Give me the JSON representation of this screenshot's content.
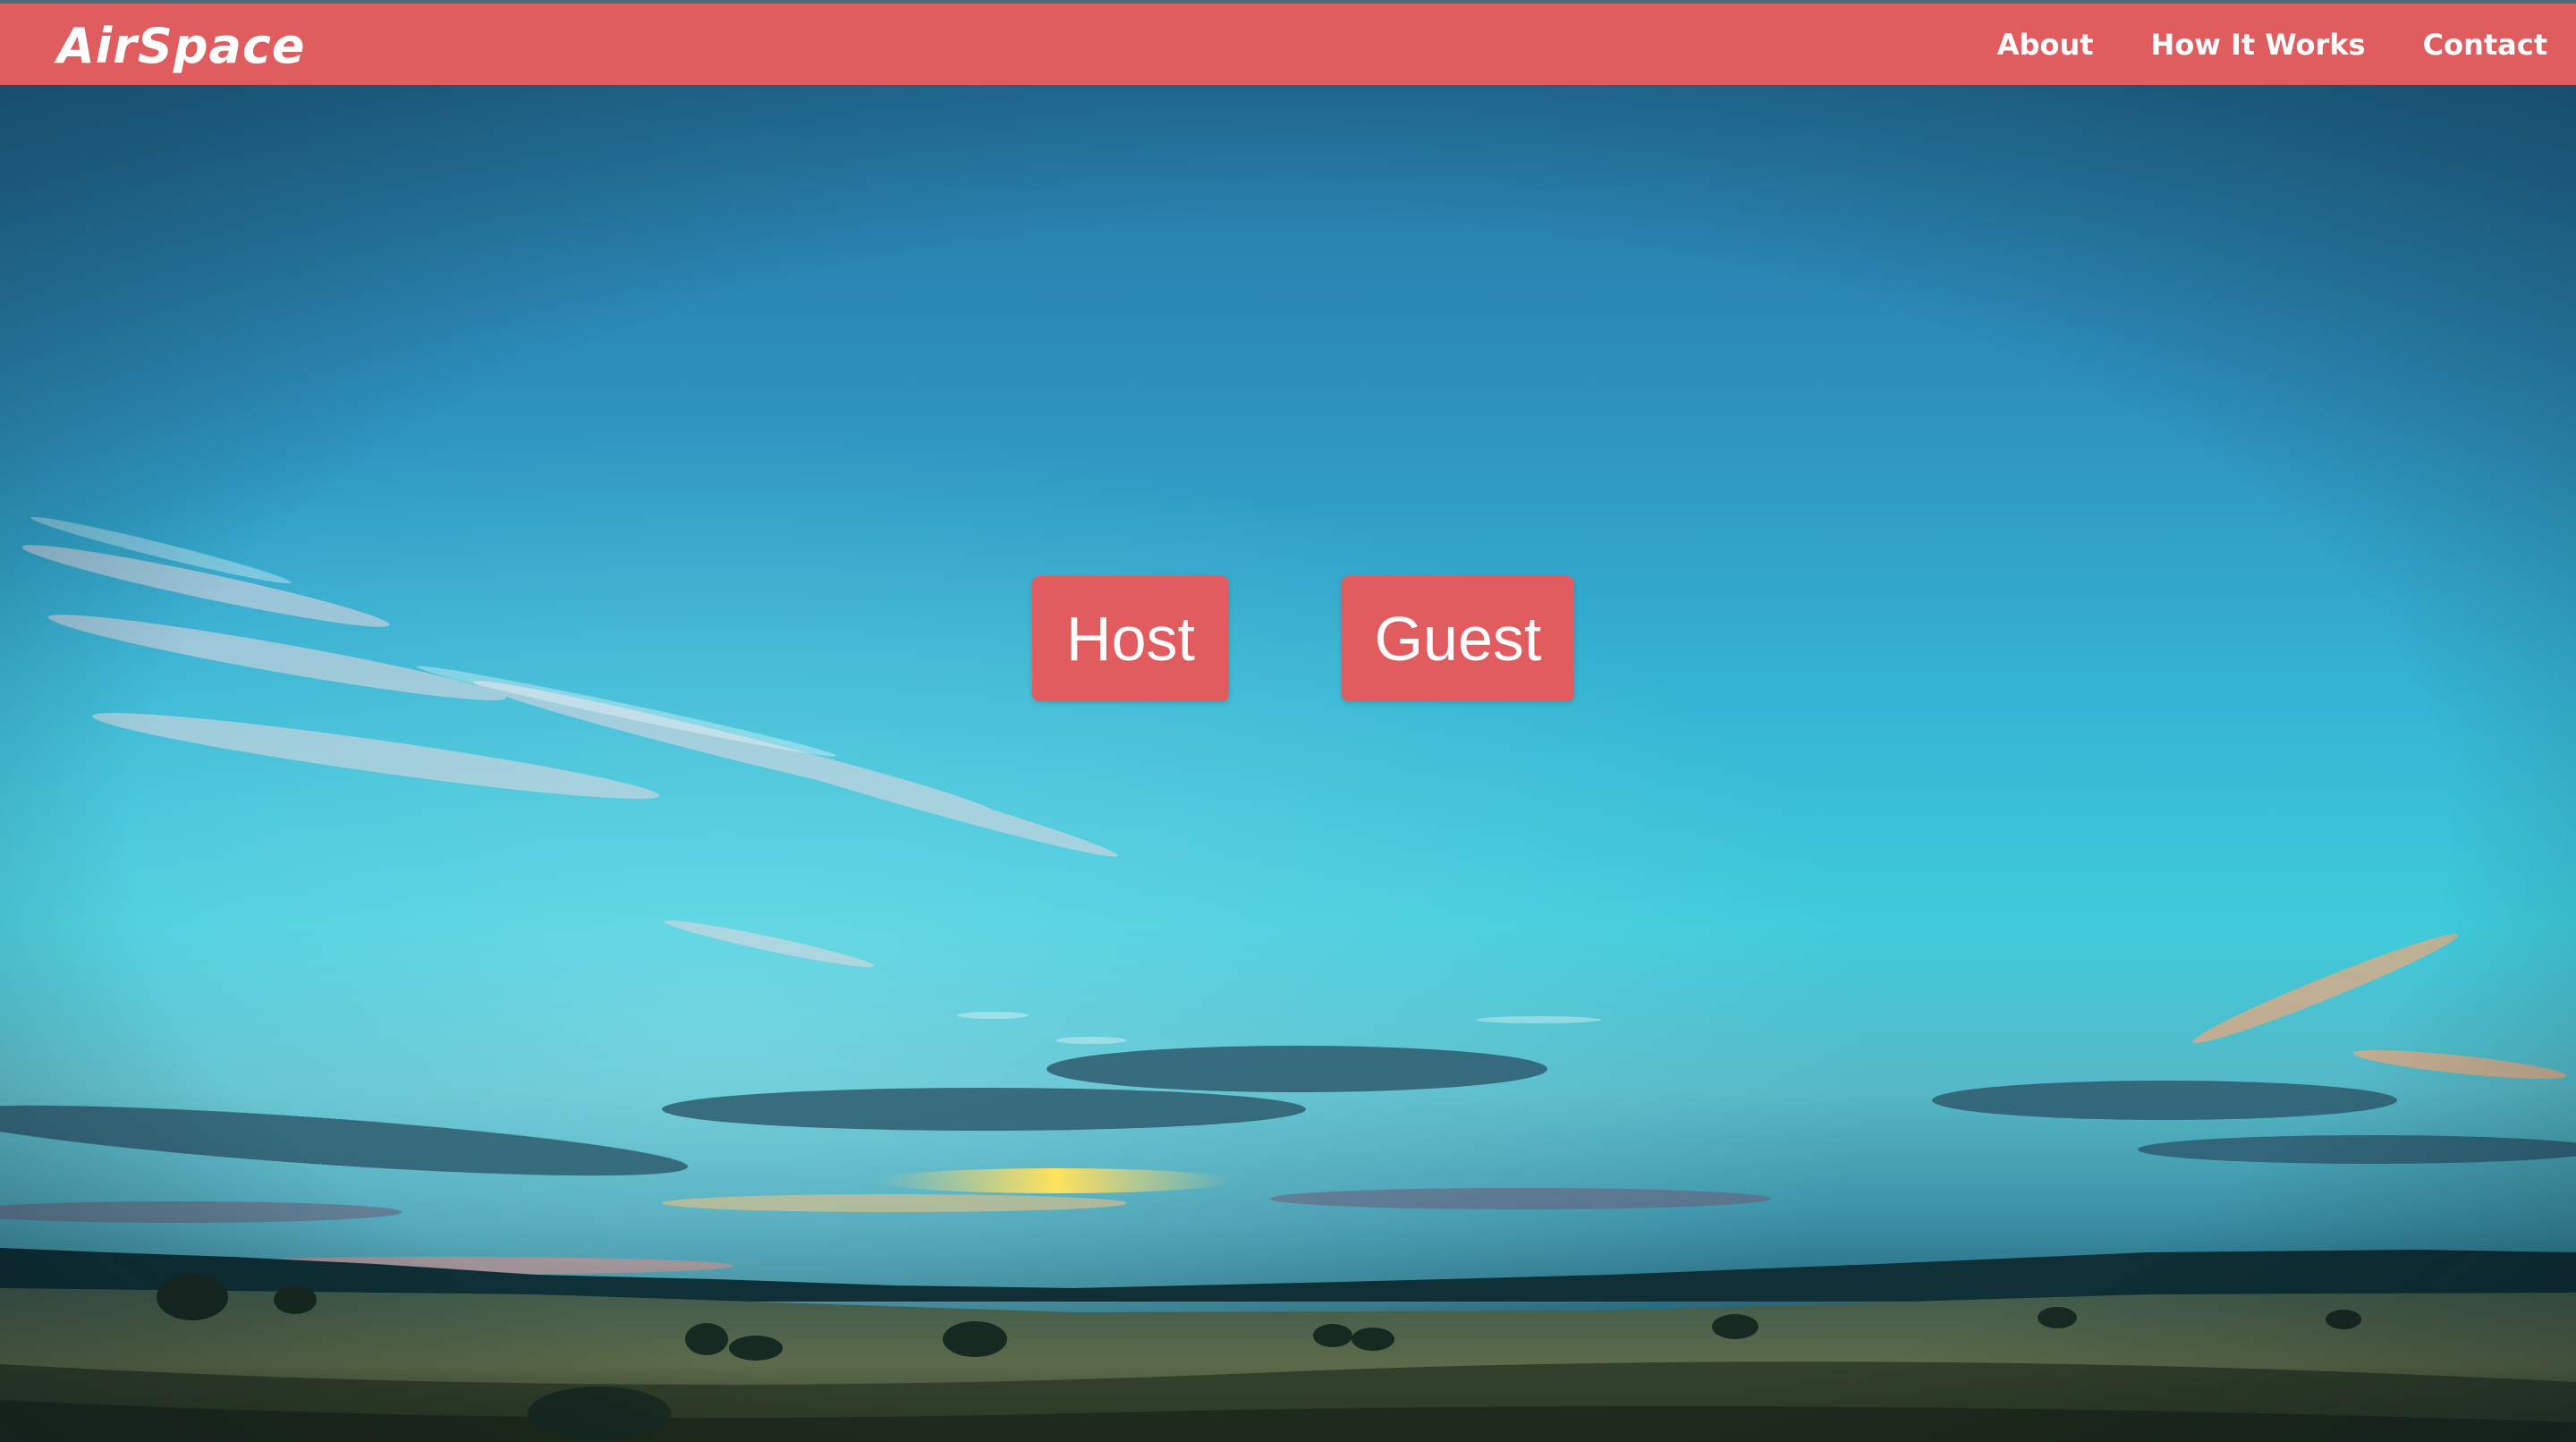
{
  "navbar": {
    "brand": "AirSpace",
    "links": [
      {
        "label": "About"
      },
      {
        "label": "How It Works"
      },
      {
        "label": "Contact"
      }
    ]
  },
  "hero": {
    "buttons": {
      "host_label": "Host",
      "guest_label": "Guest"
    },
    "background_description_icon": "landscape-sky-image"
  },
  "colors": {
    "brand_accent": "#e05d5f",
    "button_bg": "#e05c5e",
    "text_on_accent": "#ffffff"
  }
}
